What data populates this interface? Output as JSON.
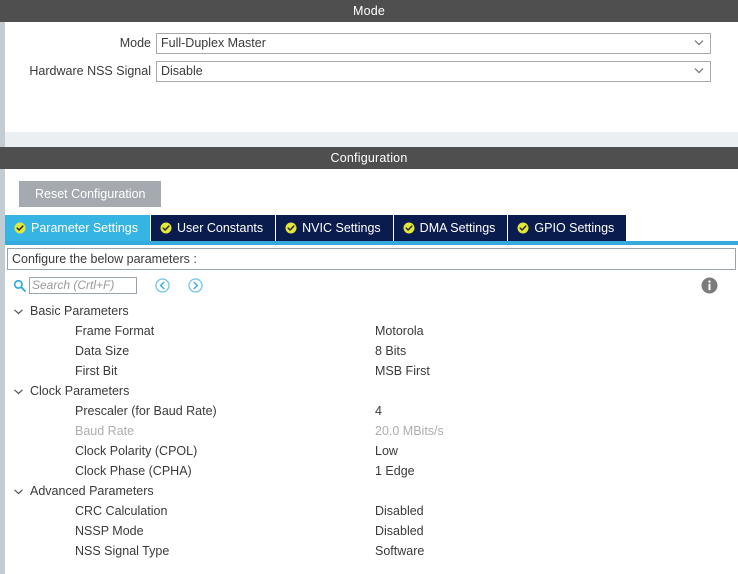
{
  "mode_panel": {
    "title": "Mode",
    "fields": [
      {
        "label": "Mode",
        "value": "Full-Duplex Master",
        "icon": "chevron-down-icon"
      },
      {
        "label": "Hardware NSS Signal",
        "value": "Disable",
        "icon": "chevron-down-icon"
      }
    ]
  },
  "configuration_panel": {
    "title": "Configuration",
    "reset_button": "Reset Configuration",
    "tabs": [
      {
        "label": "Parameter Settings",
        "active": true,
        "icon": "check-circle-icon"
      },
      {
        "label": "User Constants",
        "active": false,
        "icon": "check-circle-icon"
      },
      {
        "label": "NVIC Settings",
        "active": false,
        "icon": "check-circle-icon"
      },
      {
        "label": "DMA Settings",
        "active": false,
        "icon": "check-circle-icon"
      },
      {
        "label": "GPIO Settings",
        "active": false,
        "icon": "check-circle-icon"
      }
    ],
    "configure_hint": "Configure the below parameters :",
    "search": {
      "placeholder": "Search (Crtl+F)",
      "value": "",
      "icon": "search-icon",
      "prev_icon": "back-arrow-icon",
      "next_icon": "forward-arrow-icon"
    },
    "info_icon": "info-icon",
    "groups": [
      {
        "label": "Basic Parameters",
        "expanded": true,
        "rows": [
          {
            "name": "Frame Format",
            "value": "Motorola",
            "disabled": false
          },
          {
            "name": "Data Size",
            "value": "8 Bits",
            "disabled": false
          },
          {
            "name": "First Bit",
            "value": "MSB First",
            "disabled": false
          }
        ]
      },
      {
        "label": "Clock Parameters",
        "expanded": true,
        "rows": [
          {
            "name": "Prescaler (for Baud Rate)",
            "value": "4",
            "disabled": false
          },
          {
            "name": "Baud Rate",
            "value": "20.0 MBits/s",
            "disabled": true
          },
          {
            "name": "Clock Polarity (CPOL)",
            "value": "Low",
            "disabled": false
          },
          {
            "name": "Clock Phase (CPHA)",
            "value": "1 Edge",
            "disabled": false
          }
        ]
      },
      {
        "label": "Advanced Parameters",
        "expanded": true,
        "rows": [
          {
            "name": "CRC Calculation",
            "value": "Disabled",
            "disabled": false
          },
          {
            "name": "NSSP Mode",
            "value": "Disabled",
            "disabled": false
          },
          {
            "name": "NSS Signal Type",
            "value": "Software",
            "disabled": false
          }
        ]
      }
    ]
  },
  "colors": {
    "panel_header_bg": "#4f4f4f",
    "tab_active_bg": "#36b5e5",
    "tab_inactive_bg": "#0a1b4e",
    "tab_underline": "#36a9dd",
    "accent_blue": "#36a9dd",
    "check_badge": "#e3e83a",
    "disabled_text": "#adadad",
    "reset_button_bg": "#a5aab0",
    "gutter": "#c3ccd2"
  }
}
